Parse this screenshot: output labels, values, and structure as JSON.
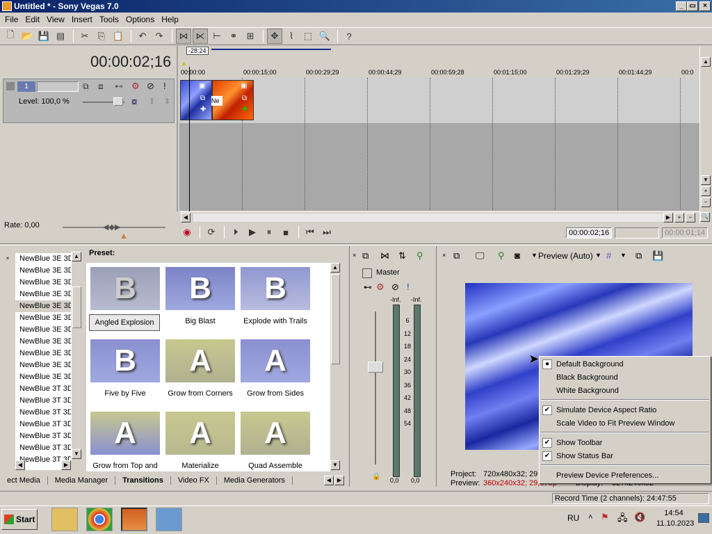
{
  "window": {
    "title": "Untitled * - Sony Vegas 7.0",
    "min": "_",
    "max": "▭",
    "close": "×"
  },
  "menu": [
    "File",
    "Edit",
    "View",
    "Insert",
    "Tools",
    "Options",
    "Help"
  ],
  "timeline": {
    "timecode": "00:00:02;16",
    "marker": "-28:24",
    "ruler": [
      "00:00:00",
      "00:00:15;00",
      "00:00:29;29",
      "00:00:44;29",
      "00:00:59;28",
      "00:01:15;00",
      "00:01:29;29",
      "00:01:44;29",
      "00:0"
    ],
    "track_level": "Level: 100,0 %",
    "track_num": "1",
    "clip_label": "Ne",
    "rate": "Rate: 0,00",
    "cursor_tc": "00:00:02;16",
    "sel_start": "",
    "sel_len": "00:00:01;14"
  },
  "transitions": {
    "preset_header": "Preset:",
    "list": [
      "NewBlue 3E 3D",
      "NewBlue 3E 3D",
      "NewBlue 3E 3D",
      "NewBlue 3E 3D",
      "NewBlue 3E 3D",
      "NewBlue 3E 3D",
      "NewBlue 3E 3D",
      "NewBlue 3E 3D",
      "NewBlue 3E 3D",
      "NewBlue 3E 3D",
      "NewBlue 3E 3D",
      "NewBlue 3T 3D",
      "NewBlue 3T 3D",
      "NewBlue 3T 3D",
      "NewBlue 3T 3D",
      "NewBlue 3T 3D",
      "NewBlue 3T 3D",
      "NewBlue 3T 3D"
    ],
    "presets": [
      {
        "name": "Angled Explosion",
        "glyph": "B"
      },
      {
        "name": "Big Blast",
        "glyph": "B"
      },
      {
        "name": "Explode with Trails",
        "glyph": "B"
      },
      {
        "name": "Five by Five",
        "glyph": "B"
      },
      {
        "name": "Grow from Corners",
        "glyph": "A"
      },
      {
        "name": "Grow from Sides",
        "glyph": "A"
      },
      {
        "name": "Grow from Top and",
        "glyph": "A"
      },
      {
        "name": "Materialize",
        "glyph": "A"
      },
      {
        "name": "Quad Assemble",
        "glyph": "A"
      }
    ]
  },
  "tabs": [
    "ect Media",
    "Media Manager",
    "Transitions",
    "Video FX",
    "Media Generators"
  ],
  "mixer": {
    "label": "Master",
    "top_left": "-Inf.",
    "top_right": "-Inf.",
    "scale": [
      "6",
      "12",
      "18",
      "24",
      "30",
      "36",
      "42",
      "48",
      "54"
    ],
    "bottom_left": "0,0",
    "bottom_right": "0,0"
  },
  "preview": {
    "mode": "Preview (Auto)",
    "project_label": "Project:",
    "project_value": "720x480x32; 29",
    "preview_label": "Preview:",
    "preview_value": "360x240x32; 29,970p",
    "display_label": "Display:",
    "display_value": "327x240x32"
  },
  "context_menu": {
    "items": [
      {
        "label": "Default Background",
        "mark": "●"
      },
      {
        "label": "Black Background",
        "mark": ""
      },
      {
        "label": "White Background",
        "mark": ""
      },
      {
        "label": "Simulate Device Aspect Ratio",
        "mark": "✔"
      },
      {
        "label": "Scale Video to Fit Preview Window",
        "mark": ""
      },
      {
        "label": "Show Toolbar",
        "mark": "✔"
      },
      {
        "label": "Show Status Bar",
        "mark": "✔"
      },
      {
        "label": "Preview Device Preferences...",
        "mark": ""
      }
    ]
  },
  "statusbar": {
    "record_time": "Record Time (2 channels): 24:47:55"
  },
  "taskbar": {
    "start": "Start",
    "lang": "RU",
    "time": "14:54",
    "date": "11.10.2023"
  }
}
